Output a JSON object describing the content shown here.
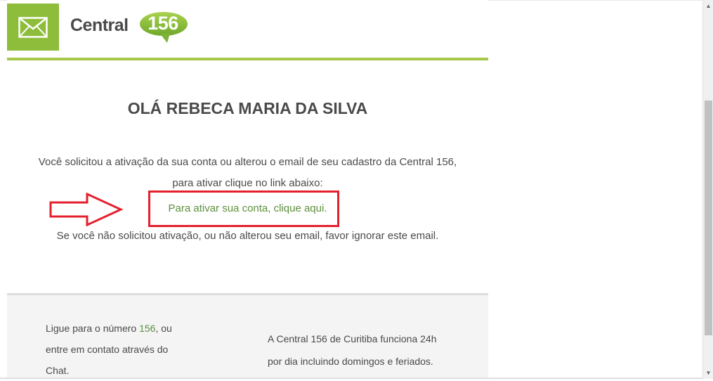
{
  "header": {
    "brand_word": "Central",
    "brand_number": "156",
    "mail_icon": "envelope-icon",
    "accent_color": "#8dbd3b"
  },
  "main": {
    "greeting": "OLÁ REBECA MARIA DA SILVA",
    "message": "Você solicitou a ativação da sua conta ou alterou o email de seu cadastro da Central 156, para ativar clique no link abaixo:",
    "activation_link": "Para ativar sua conta, clique aqui.",
    "ignore_notice": "Se você não solicitou ativação, ou não alterou seu email, favor ignorar este email.",
    "highlight_color": "#e4202e",
    "link_color": "#5c8f3c",
    "annotation_arrow": "right-arrow-icon"
  },
  "footer": {
    "left_prefix": "Ligue para o número ",
    "left_number": "156",
    "left_suffix": ", ou entre em contato através do Chat.",
    "right_text": "A Central 156 de Curitiba funciona 24h por dia incluindo domingos e feriados."
  },
  "scrollbar": {
    "up_icon": "scroll-up-arrow-icon",
    "down_icon": "scroll-down-arrow-icon"
  }
}
